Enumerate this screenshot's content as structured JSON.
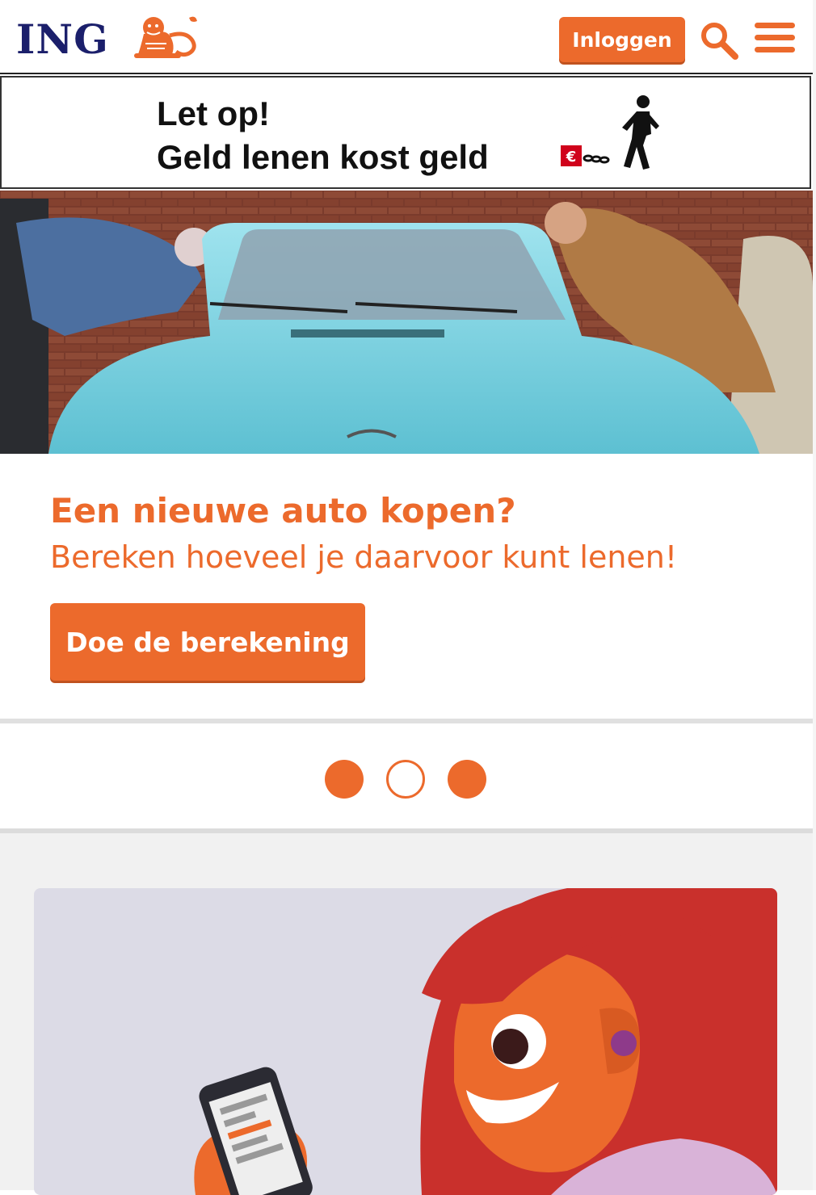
{
  "header": {
    "logo_text": "ING",
    "login_label": "Inloggen",
    "icons": [
      "lion-logo-icon",
      "search-icon",
      "hamburger-menu-icon"
    ],
    "accent_color": "#ec6a2c",
    "logo_color": "#1b1f6b"
  },
  "warning": {
    "line1": "Let op!",
    "line2": "Geld lenen kost geld",
    "euro_symbol": "€"
  },
  "promo": {
    "title": "Een nieuwe auto kopen?",
    "subtitle": "Bereken hoeveel je daarvoor kunt lenen!",
    "cta_label": "Doe de berekening"
  },
  "carousel": {
    "dots": [
      "filled",
      "empty",
      "filled"
    ],
    "active_index": 1
  }
}
